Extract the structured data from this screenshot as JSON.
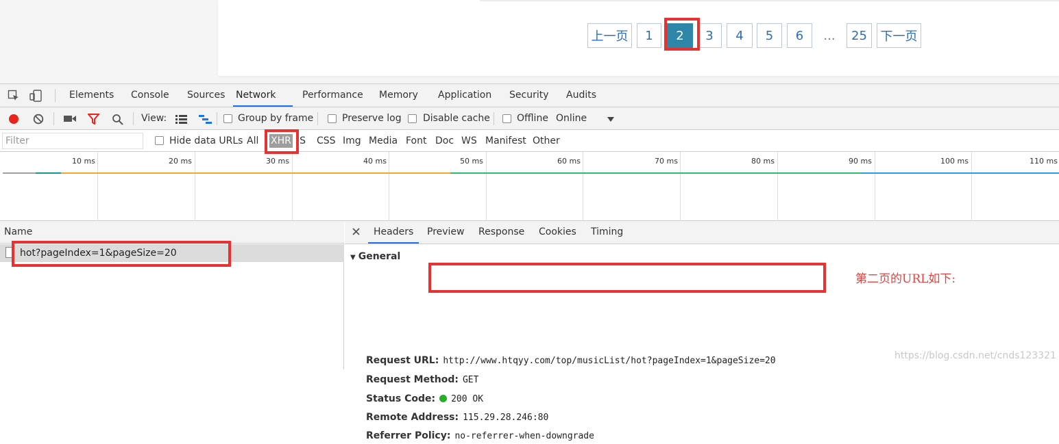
{
  "pagination": {
    "prev": "上一页",
    "pages": [
      "1",
      "2",
      "3",
      "4",
      "5",
      "6"
    ],
    "active_page": "2",
    "ellipsis": "...",
    "last": "25",
    "next": "下一页"
  },
  "devtools": {
    "tabs": [
      "Elements",
      "Console",
      "Sources",
      "Network",
      "Performance",
      "Memory",
      "Application",
      "Security",
      "Audits"
    ],
    "active_tab": "Network",
    "toolbar": {
      "view_label": "View:",
      "group_by_frame": "Group by frame",
      "preserve_log": "Preserve log",
      "disable_cache": "Disable cache",
      "offline": "Offline",
      "throttle": "Online"
    },
    "filter": {
      "placeholder": "Filter",
      "hide_data_urls": "Hide data URLs",
      "types": [
        "All",
        "XHR",
        "JS",
        "CSS",
        "Img",
        "Media",
        "Font",
        "Doc",
        "WS",
        "Manifest",
        "Other"
      ],
      "selected_type": "XHR"
    },
    "timeline": {
      "ticks": [
        "10 ms",
        "20 ms",
        "30 ms",
        "40 ms",
        "50 ms",
        "60 ms",
        "70 ms",
        "80 ms",
        "90 ms",
        "100 ms",
        "110 ms"
      ]
    },
    "name_panel": {
      "header": "Name",
      "requests": [
        "hot?pageIndex=1&pageSize=20"
      ]
    },
    "detail": {
      "tabs": [
        "Headers",
        "Preview",
        "Response",
        "Cookies",
        "Timing"
      ],
      "active_tab": "Headers",
      "section_title": "General",
      "rows": [
        {
          "key": "Request URL:",
          "value": "http://www.htqyy.com/top/musicList/hot?pageIndex=1&pageSize=20"
        },
        {
          "key": "Request Method:",
          "value": "GET"
        },
        {
          "key": "Status Code:",
          "value": "200 OK"
        },
        {
          "key": "Remote Address:",
          "value": "115.29.28.246:80"
        },
        {
          "key": "Referrer Policy:",
          "value": "no-referrer-when-downgrade"
        }
      ]
    }
  },
  "annotation": "第二页的URL如下:",
  "watermark": "https://blog.csdn.net/cnds123321",
  "colors": {
    "highlight": "#e83232",
    "active_page": "#2e86a8",
    "tab_underline": "#1a73e8",
    "status_ok": "#26b026"
  }
}
